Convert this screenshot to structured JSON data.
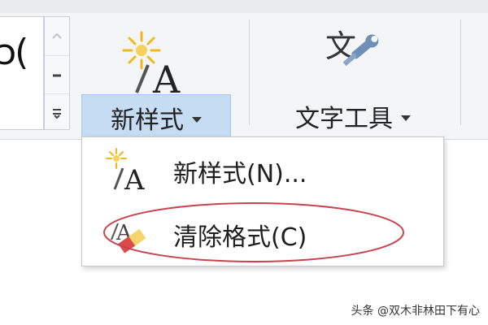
{
  "ribbon": {
    "gallery_preview_text": "ɔ(",
    "new_style_button": {
      "label": "新样式",
      "icon": "new-style-icon"
    },
    "text_tools_button": {
      "label": "文字工具",
      "icon": "text-tools-icon"
    }
  },
  "dropdown": {
    "items": [
      {
        "label": "新样式(N)...",
        "icon": "new-style-icon"
      },
      {
        "label": "清除格式(C)",
        "icon": "clear-format-icon"
      }
    ]
  },
  "watermark": {
    "text": "头条 @双木非林田下有心"
  },
  "colors": {
    "ribbon_bg": "#f4f5f7",
    "button_active": "#c5dcf3",
    "highlight_ellipse": "#c9434f",
    "icon_yellow": "#f1b81f",
    "icon_blue": "#4f80c0"
  }
}
